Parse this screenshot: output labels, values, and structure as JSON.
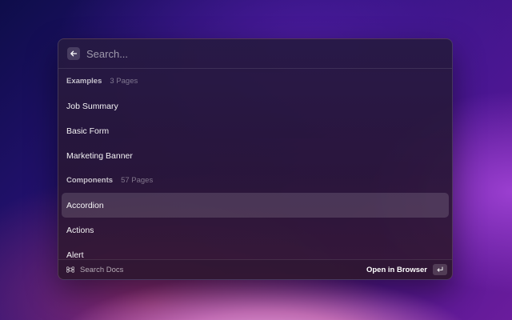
{
  "search": {
    "value": "",
    "placeholder": "Search..."
  },
  "sections": [
    {
      "title": "Examples",
      "count": "3 Pages",
      "items": [
        "Job Summary",
        "Basic Form",
        "Marketing Banner"
      ]
    },
    {
      "title": "Components",
      "count": "57 Pages",
      "items": [
        "Accordion",
        "Actions",
        "Alert"
      ]
    }
  ],
  "selected_item": "Accordion",
  "footer": {
    "left_label": "Search Docs",
    "action_label": "Open in Browser"
  },
  "icons": {
    "back": "arrow-left-icon",
    "footer": "command-icon",
    "enter": "enter-key-icon"
  }
}
